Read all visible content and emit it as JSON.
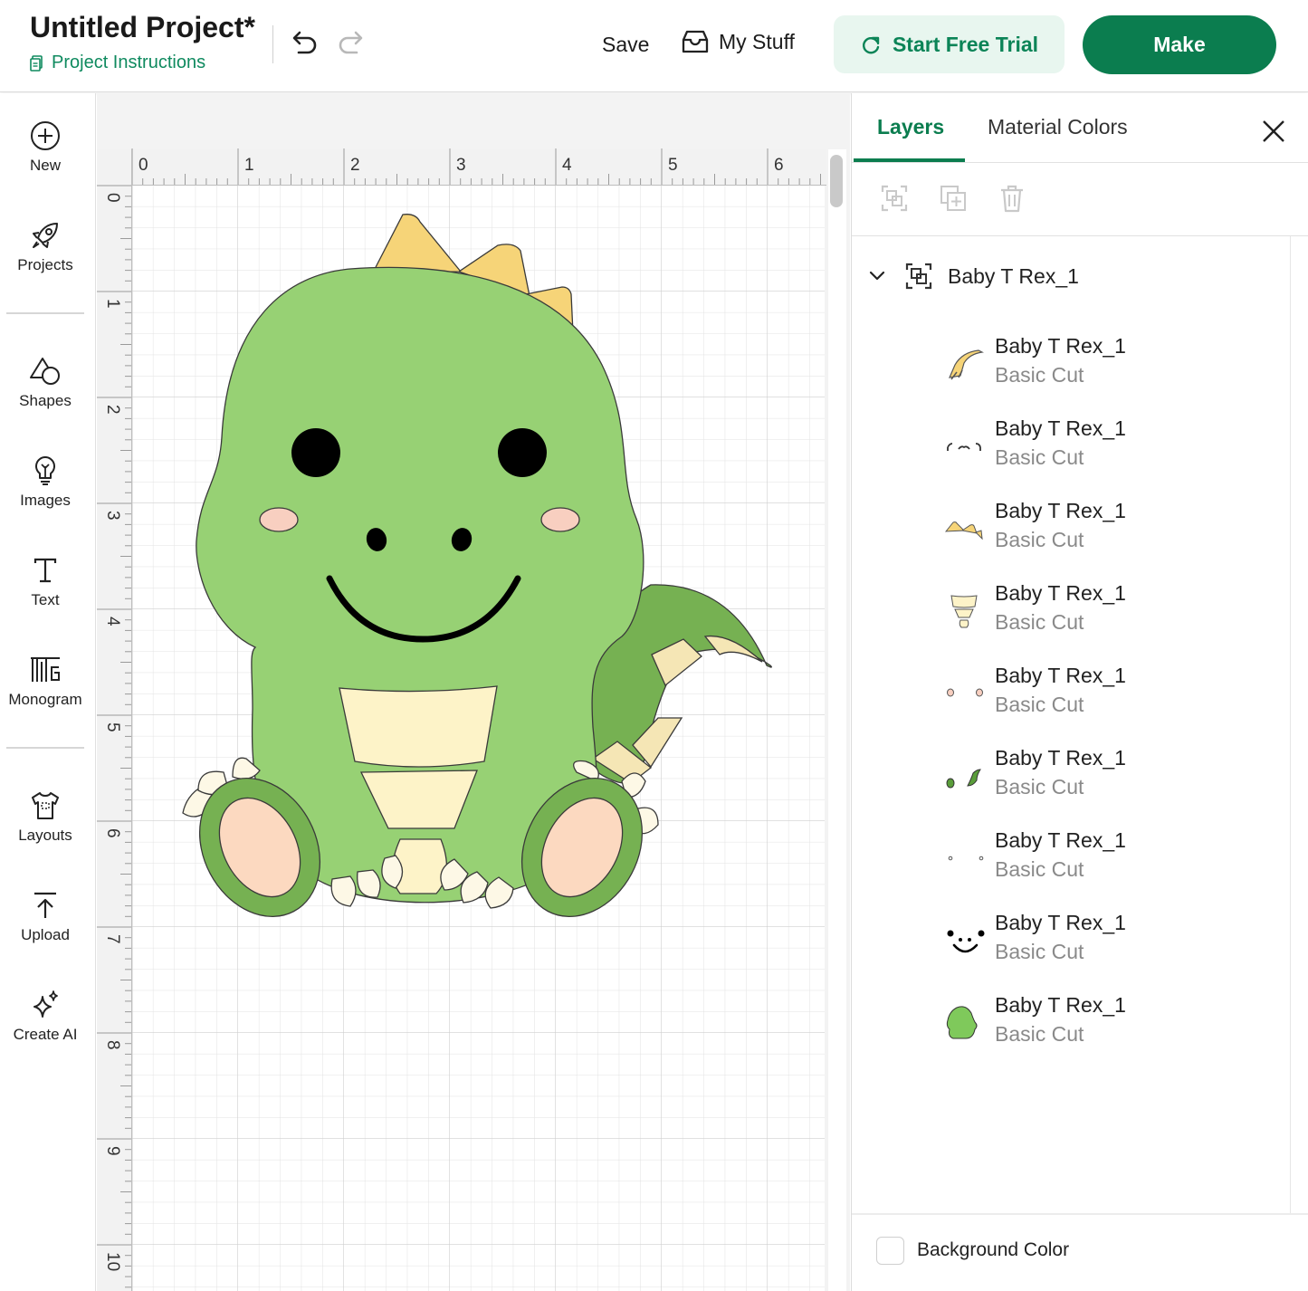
{
  "header": {
    "title": "Untitled Project*",
    "instructions_label": "Project Instructions",
    "save_label": "Save",
    "mystuff_label": "My Stuff",
    "trial_label": "Start Free Trial",
    "make_label": "Make"
  },
  "sidebar": {
    "items": [
      {
        "label": "New",
        "icon": "plus-circle-icon"
      },
      {
        "label": "Projects",
        "icon": "rocket-icon"
      },
      {
        "label": "Shapes",
        "icon": "shapes-icon"
      },
      {
        "label": "Images",
        "icon": "lightbulb-icon"
      },
      {
        "label": "Text",
        "icon": "text-icon"
      },
      {
        "label": "Monogram",
        "icon": "monogram-icon"
      },
      {
        "label": "Layouts",
        "icon": "shirt-icon"
      },
      {
        "label": "Upload",
        "icon": "upload-icon"
      },
      {
        "label": "Create AI",
        "icon": "sparkle-icon"
      }
    ]
  },
  "canvas": {
    "ruler_top": [
      "0",
      "1",
      "2",
      "3",
      "4",
      "5",
      "6"
    ],
    "ruler_left": [
      "0",
      "1",
      "2",
      "3",
      "4",
      "5",
      "6",
      "7",
      "8",
      "9",
      "10"
    ]
  },
  "panel": {
    "tab_layers": "Layers",
    "tab_colors": "Material Colors",
    "group_name": "Baby T Rex_1",
    "layers": [
      {
        "name": "Baby T Rex_1",
        "type": "Basic Cut",
        "thumb": "outline-thumb"
      },
      {
        "name": "Baby T Rex_1",
        "type": "Basic Cut",
        "thumb": "lashes-thumb"
      },
      {
        "name": "Baby T Rex_1",
        "type": "Basic Cut",
        "thumb": "spikes-thumb"
      },
      {
        "name": "Baby T Rex_1",
        "type": "Basic Cut",
        "thumb": "belly-thumb"
      },
      {
        "name": "Baby T Rex_1",
        "type": "Basic Cut",
        "thumb": "cheeks-thumb"
      },
      {
        "name": "Baby T Rex_1",
        "type": "Basic Cut",
        "thumb": "tail-thumb"
      },
      {
        "name": "Baby T Rex_1",
        "type": "Basic Cut",
        "thumb": "dots-thumb"
      },
      {
        "name": "Baby T Rex_1",
        "type": "Basic Cut",
        "thumb": "face-thumb"
      },
      {
        "name": "Baby T Rex_1",
        "type": "Basic Cut",
        "thumb": "body-thumb"
      }
    ],
    "background_color_label": "Background Color"
  },
  "colors": {
    "accent": "#0b7d4f",
    "body_green": "#97d174",
    "dark_green": "#76b152",
    "spike_yellow": "#f6d478",
    "belly_cream": "#fdf3c8",
    "cheek_pink": "#f8cfc0",
    "paw_pink": "#fcd9c0"
  }
}
